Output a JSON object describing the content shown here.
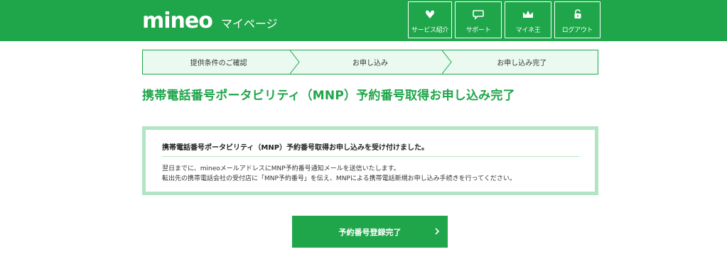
{
  "header": {
    "logo": "mineo",
    "subtitle": "マイページ",
    "nav": [
      {
        "label": "サービス紹介",
        "icon": "heart-leaf-icon"
      },
      {
        "label": "サポート",
        "icon": "chat-bubble-icon"
      },
      {
        "label": "マイネ王",
        "icon": "crown-icon"
      },
      {
        "label": "ログアウト",
        "icon": "lock-icon"
      }
    ]
  },
  "steps": [
    {
      "label": "提供条件のご確認"
    },
    {
      "label": "お申し込み"
    },
    {
      "label": "お申し込み完了"
    }
  ],
  "page": {
    "title": "携帯電話番号ポータビリティ（MNP）予約番号取得お申し込み完了"
  },
  "notice": {
    "heading": "携帯電話番号ポータビリティ（MNP）予約番号取得お申し込みを受け付けました。",
    "line1": "翌日までに、mineoメールアドレスにMNP予約番号通知メールを送信いたします。",
    "line2": "転出先の携帯電話会社の受付店に「MNP予約番号」を伝え、MNPによる携帯電話新規お申し込み手続きを行ってください。"
  },
  "action": {
    "button_label": "予約番号登録完了",
    "icon": "chevron-right-icon"
  },
  "colors": {
    "brand_green": "#1fa54a",
    "step_bg": "#eafaf0",
    "notice_border": "#b2e5c3"
  }
}
